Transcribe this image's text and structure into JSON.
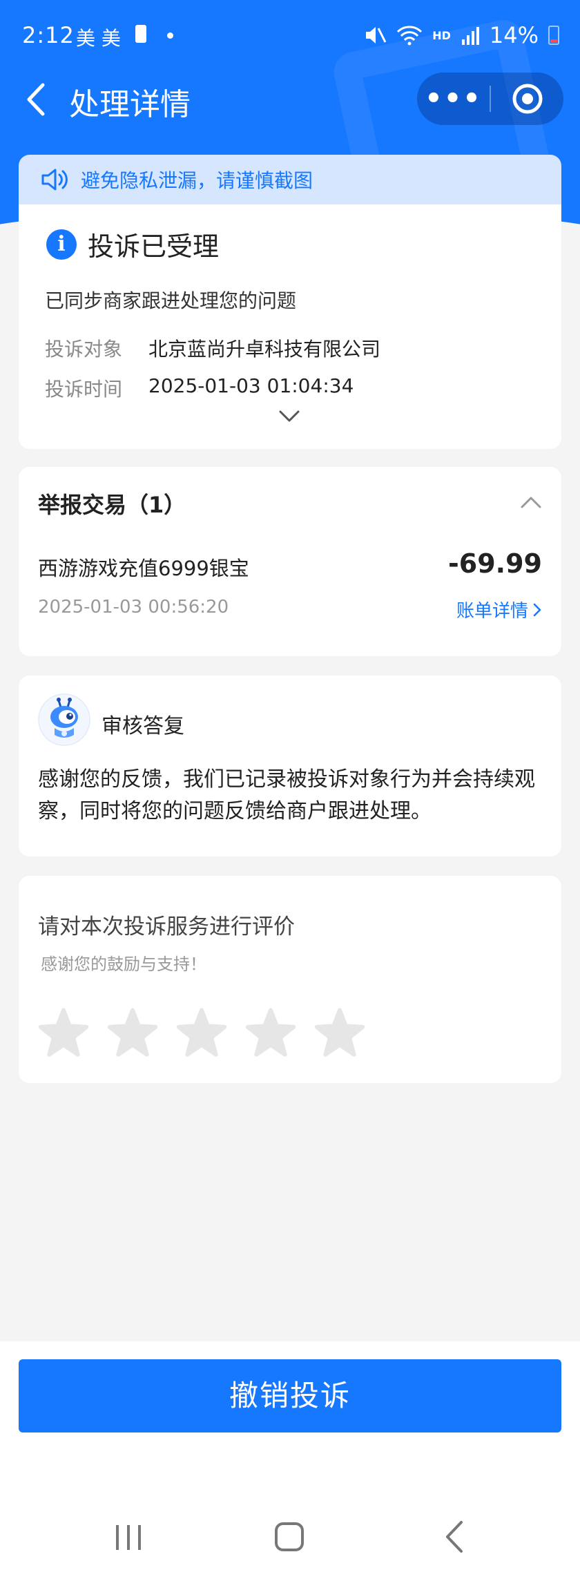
{
  "status_bar": {
    "time": "2:12",
    "left_icons": "美 美",
    "network": "HD",
    "battery": "14%"
  },
  "nav": {
    "title": "处理详情",
    "more_label": "•••"
  },
  "notice": {
    "text": "避免隐私泄漏，请谨慎截图"
  },
  "status_card": {
    "info_glyph": "i",
    "title": "投诉已受理",
    "subtitle": "已同步商家跟进处理您的问题",
    "target_label": "投诉对象",
    "target_value": "北京蓝尚升卓科技有限公司",
    "time_label": "投诉时间",
    "time_value": "2025-01-03 01:04:34"
  },
  "report": {
    "title": "举报交易（1）",
    "item_name": "西游游戏充值6999银宝",
    "amount": "-69.99",
    "date": "2025-01-03 00:56:20",
    "link_label": "账单详情"
  },
  "review": {
    "title": "审核答复",
    "body": "感谢您的反馈，我们已记录被投诉对象行为并会持续观察，同时将您的问题反馈给商户跟进处理。"
  },
  "rating": {
    "title": "请对本次投诉服务进行评价",
    "subtitle": "感谢您的鼓励与支持！",
    "value": 0,
    "max": 5
  },
  "actions": {
    "cancel_label": "撤销投诉"
  },
  "colors": {
    "brand": "#1677ff",
    "notice_bg": "#d6e6ff",
    "page_bg": "#f4f4f4",
    "star_empty": "#e6e6e6"
  },
  "icons": [
    "back-icon",
    "more-icon",
    "target-icon",
    "speaker-icon",
    "info-icon",
    "chevron-down-icon",
    "chevron-up-icon",
    "chevron-right-icon",
    "robot-avatar-icon",
    "star-icon",
    "recent-apps-icon",
    "home-icon",
    "nav-back-icon"
  ]
}
